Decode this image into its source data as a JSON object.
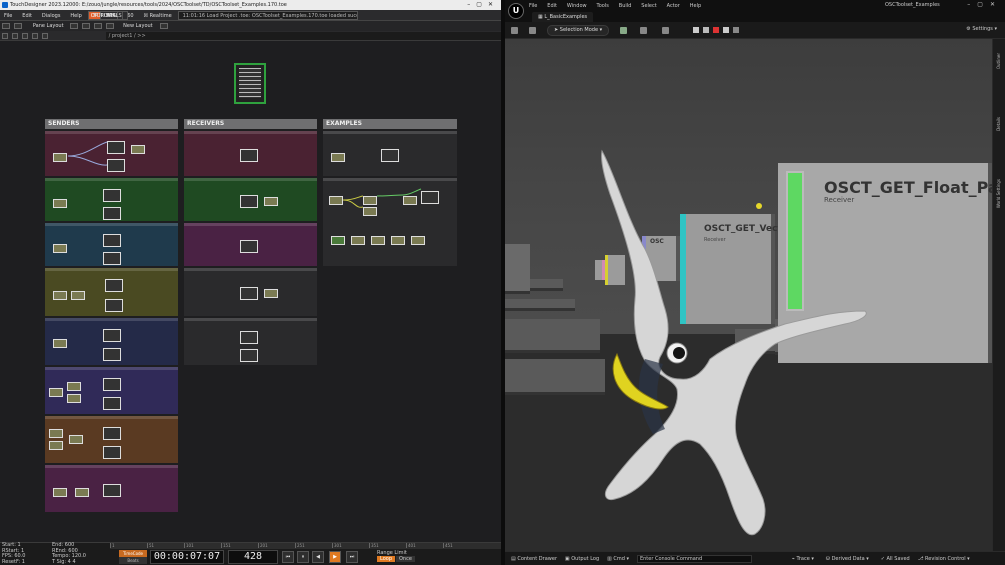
{
  "td": {
    "title": "TouchDesigner 2023.12000: E:/zouo/jungle/resources/tools/2024/OSCToolset/TD/OSCToolset_Examples.170.toe",
    "menu": [
      "File",
      "Edit",
      "Dialogs",
      "Help"
    ],
    "buttons": {
      "wiki": "WIKI",
      "forum": "FORUM",
      "tutorials": "TUTORIALS",
      "cook": "OP",
      "fps_label": "FPS:",
      "fps_value": "60",
      "realtime": "Realtime"
    },
    "message": "11:01:16 Load Project .toe: OSCToolset_Examples.170.toe loaded succes",
    "pane_layout": "Pane Layout",
    "new_layout": "New Layout",
    "path": "/ project1 / >>",
    "columns": [
      {
        "label": "SENDERS"
      },
      {
        "label": "RECEIVERS"
      },
      {
        "label": "EXAMPLES"
      }
    ],
    "stats": {
      "start_label": "Start:",
      "start": "1",
      "rstart_label": "RStart:",
      "rstart": "1",
      "fps_label": "FPS:",
      "fps": "60.0",
      "resetf_label": "ResetF:",
      "resetf": "1",
      "end_label": "End:",
      "end": "600",
      "rend_label": "REnd:",
      "rend": "600",
      "tempo_label": "Tempo:",
      "tempo": "120.0",
      "tsig_label": "T Sig:",
      "tsig": "4 4"
    },
    "ruler": [
      "1",
      "51",
      "101",
      "151",
      "201",
      "251",
      "301",
      "351",
      "401",
      "451"
    ],
    "timecode_toggle": "TimeCode",
    "beats_toggle": "Beats",
    "timecode": "00:00:07:07",
    "frame": "428",
    "transport": [
      "⏮",
      "⏸",
      "◀",
      "▶",
      "⏭"
    ],
    "range_label": "Range Limit",
    "loop": "Loop",
    "once": "Once"
  },
  "ue": {
    "menu": [
      "File",
      "Edit",
      "Window",
      "Tools",
      "Build",
      "Select",
      "Actor",
      "Help"
    ],
    "level_tab": "L_BasicExamples",
    "window_title": "OSCToolset_Examples",
    "selection_mode": "Selection Mode",
    "settings": "Settings",
    "panels": [
      {
        "title": "OSCT_GET_Float_Pack",
        "subtitle": "Receiver"
      },
      {
        "title": "OSCT_GET_Vecto",
        "subtitle": "Receiver"
      },
      {
        "title": "OSC",
        "subtitle": ""
      }
    ],
    "side_tabs": [
      "Outliner",
      "Details",
      "World Settings"
    ],
    "bottom": {
      "content_drawer": "Content Drawer",
      "output_log": "Output Log",
      "cmd": "Cmd",
      "console_placeholder": "Enter Console Command",
      "trace": "Trace",
      "derived_data": "Derived Data",
      "all_saved": "All Saved",
      "revision_control": "Revision Control"
    }
  }
}
